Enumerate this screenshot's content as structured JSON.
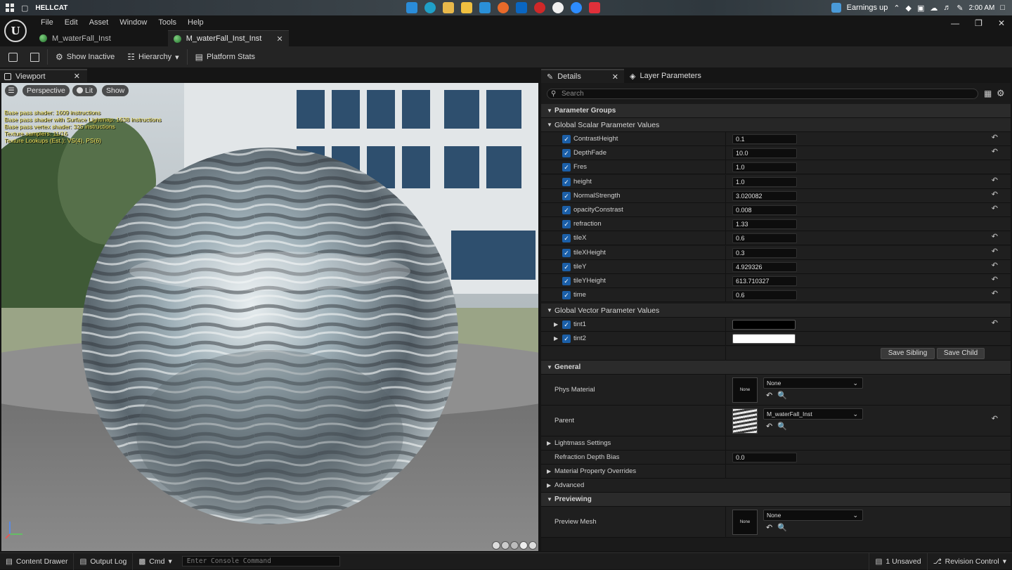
{
  "taskbar": {
    "title": "HELLCAT",
    "widget": "Earnings up",
    "time": "2:00 AM"
  },
  "menu": [
    "File",
    "Edit",
    "Asset",
    "Window",
    "Tools",
    "Help"
  ],
  "doc_tabs": [
    {
      "label": "M_waterFall_Inst"
    },
    {
      "label": "M_waterFall_Inst_Inst",
      "active": true
    }
  ],
  "toolbar": {
    "show_inactive": "Show Inactive",
    "hierarchy": "Hierarchy",
    "platform_stats": "Platform Stats"
  },
  "viewport": {
    "tab_label": "Viewport",
    "perspective": "Perspective",
    "lit": "Lit",
    "show": "Show",
    "stats": [
      "Base pass shader: 1609 instructions",
      "Base pass shader with Surface Lightmap: 1638 instructions",
      "Base pass vertex shader: 325 instructions",
      "Texture samplers: 11/16",
      "Texture Lookups (Est.): VS(4), PS(6)"
    ]
  },
  "details": {
    "tab_label": "Details",
    "layer_tab_label": "Layer Parameters",
    "search_placeholder": "Search",
    "parameter_groups": "Parameter Groups",
    "scalar_group": "Global Scalar Parameter Values",
    "scalar_params": [
      {
        "name": "ContrastHeight",
        "value": "0.1",
        "reset": true
      },
      {
        "name": "DepthFade",
        "value": "10.0",
        "reset": true
      },
      {
        "name": "Fres",
        "value": "1.0",
        "reset": false
      },
      {
        "name": "height",
        "value": "1.0",
        "reset": true
      },
      {
        "name": "NormalStrength",
        "value": "3.020082",
        "reset": true
      },
      {
        "name": "opacityConstrast",
        "value": "0.008",
        "reset": true
      },
      {
        "name": "refraction",
        "value": "1.33",
        "reset": false
      },
      {
        "name": "tileX",
        "value": "0.6",
        "reset": true
      },
      {
        "name": "tileXHeight",
        "value": "0.3",
        "reset": true
      },
      {
        "name": "tileY",
        "value": "4.929326",
        "reset": true
      },
      {
        "name": "tileYHeight",
        "value": "613.710327",
        "reset": true
      },
      {
        "name": "time",
        "value": "0.6",
        "reset": true
      }
    ],
    "vector_group": "Global Vector Parameter Values",
    "vector_params": [
      {
        "name": "tint1",
        "color": "#000000",
        "reset": true
      },
      {
        "name": "tint2",
        "color": "#ffffff",
        "reset": false
      }
    ],
    "save_sibling": "Save Sibling",
    "save_child": "Save Child",
    "general": "General",
    "phys_material_label": "Phys Material",
    "phys_material_value": "None",
    "phys_thumb": "None",
    "parent_label": "Parent",
    "parent_value": "M_waterFall_Inst",
    "lightmass": "Lightmass Settings",
    "refraction_bias_label": "Refraction Depth Bias",
    "refraction_bias_value": "0.0",
    "material_overrides": "Material Property Overrides",
    "advanced": "Advanced",
    "previewing": "Previewing",
    "preview_mesh_label": "Preview Mesh",
    "preview_mesh_value": "None",
    "preview_thumb": "None"
  },
  "bottom": {
    "content_drawer": "Content Drawer",
    "output_log": "Output Log",
    "cmd": "Cmd",
    "console_placeholder": "Enter Console Command",
    "unsaved": "1 Unsaved",
    "revision": "Revision Control"
  },
  "colors": {
    "accent_blue": "#1b5fa8",
    "panel_bg": "#1a1a1a"
  }
}
